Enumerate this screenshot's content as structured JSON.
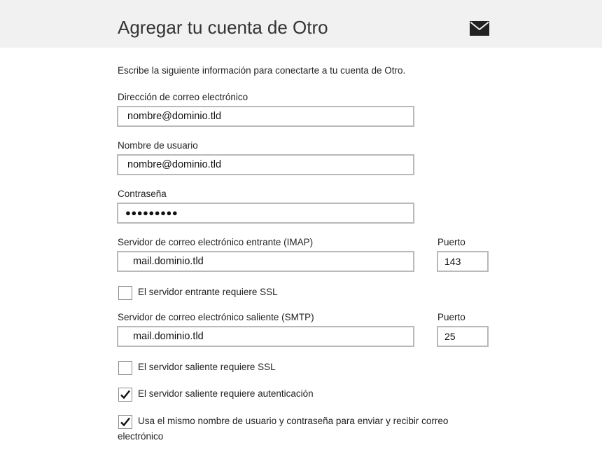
{
  "header": {
    "title": "Agregar tu cuenta de Otro",
    "icon": "mail-icon"
  },
  "form": {
    "intro": "Escribe la siguiente información para conectarte a tu cuenta de Otro.",
    "email": {
      "label": "Dirección de correo electrónico",
      "value": "nombre@dominio.tld"
    },
    "username": {
      "label": "Nombre de usuario",
      "value": "nombre@dominio.tld"
    },
    "password": {
      "label": "Contraseña",
      "value": "●●●●●●●●●"
    },
    "incoming": {
      "label": "Servidor de correo electrónico entrante (IMAP)",
      "value": "mail.dominio.tld",
      "port_label": "Puerto",
      "port": "143"
    },
    "incoming_ssl": {
      "label": "El servidor entrante requiere SSL",
      "checked": false
    },
    "outgoing": {
      "label": "Servidor de correo electrónico saliente (SMTP)",
      "value": "mail.dominio.tld",
      "port_label": "Puerto",
      "port": "25"
    },
    "outgoing_ssl": {
      "label": "El servidor saliente requiere SSL",
      "checked": false
    },
    "outgoing_auth": {
      "label": "El servidor saliente requiere autenticación",
      "checked": true
    },
    "same_credentials": {
      "label_line1": "Usa el mismo nombre de usuario y contraseña para enviar y recibir correo",
      "label_line2": "electrónico",
      "checked": true
    }
  }
}
